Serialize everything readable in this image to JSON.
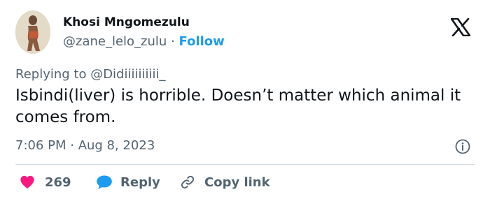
{
  "author": {
    "display_name": "Khosi Mngomezulu",
    "handle": "@zane_lelo_zulu",
    "separator": "·",
    "follow_label": "Follow"
  },
  "tweet": {
    "replying_to": "Replying to @Didiiiiiiiiii_",
    "text": "Isbindi(liver) is horrible. Doesn’t matter which animal it comes from.",
    "timestamp": "7:06 PM · Aug 8, 2023"
  },
  "actions": {
    "like_count": "269",
    "reply_label": "Reply",
    "copy_link_label": "Copy link"
  },
  "icons": {
    "brand": "x-logo-icon",
    "info": "info-icon",
    "like": "heart-icon",
    "reply": "speech-bubble-icon",
    "copy": "link-icon"
  },
  "colors": {
    "link": "#1d9bf0",
    "like": "#f91880",
    "reply": "#1d9bf0",
    "secondary_text": "#536471"
  }
}
